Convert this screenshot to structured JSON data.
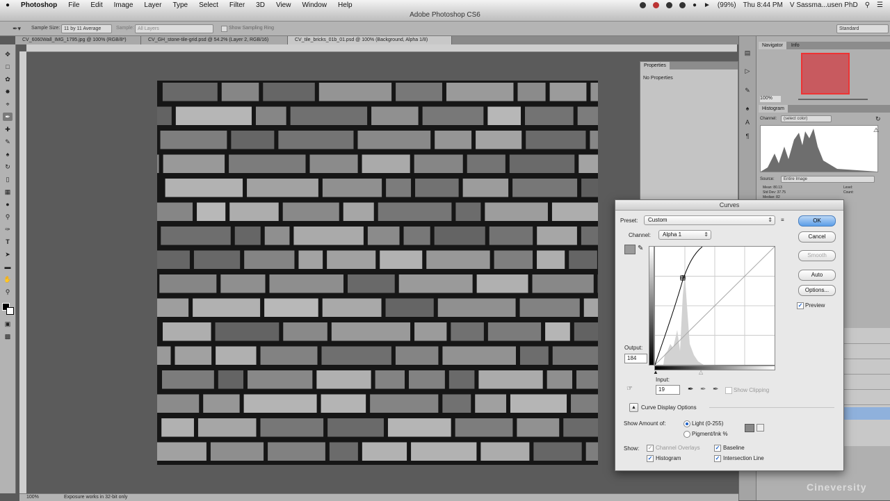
{
  "menubar": {
    "apple": "",
    "app": "Photoshop",
    "items": [
      "File",
      "Edit",
      "Image",
      "Layer",
      "Type",
      "Select",
      "Filter",
      "3D",
      "View",
      "Window",
      "Help"
    ],
    "battery": "(99%)",
    "clock": "Thu 8:44 PM",
    "user": "V Sassma...usen PhD"
  },
  "window": {
    "title": "Adobe Photoshop CS6"
  },
  "options": {
    "sample_size_label": "Sample Size:",
    "sample_size_value": "11 by 11 Average",
    "sample_label": "Sample:",
    "sample_value": "All Layers",
    "show_ring": "Show Sampling Ring",
    "workspace": "Standard"
  },
  "tabs": [
    {
      "label": "CV_6060Wall_IMG_1795.jpg @ 100% (RGB/8*)",
      "active": false
    },
    {
      "label": "CV_GH_stone-tile-grid.psd @ 54.2% (Layer 2, RGB/16)",
      "active": false
    },
    {
      "label": "CV_tile_bricks_01b_01.psd @ 100% (Background, Alpha 1/8)",
      "active": true
    }
  ],
  "properties": {
    "tab": "Properties",
    "empty": "No Properties"
  },
  "right_panels": {
    "navigator_tabs": [
      "Navigator",
      "Info"
    ],
    "zoom": "100%",
    "histogram_tab": "Histogram",
    "channel_label": "Channel:",
    "channel_value": "(select color)",
    "source_label": "Source:",
    "source_value": "Entire Image",
    "stats": [
      "Mean: 80.13",
      "Std Dev: 37.75",
      "Median: 82"
    ],
    "stats_right": [
      "Level:",
      "Count:"
    ]
  },
  "status": {
    "zoom": "100%",
    "doc": "Exposure works in 32-bit only"
  },
  "curves": {
    "title": "Curves",
    "preset_label": "Preset:",
    "preset_value": "Custom",
    "channel_label": "Channel:",
    "channel_value": "Alpha 1",
    "output_label": "Output:",
    "output_value": "184",
    "input_label": "Input:",
    "input_value": "19",
    "show_clipping": "Show Clipping",
    "display_options": "Curve Display Options",
    "show_amount_label": "Show Amount of:",
    "light": "Light  (0-255)",
    "pigment": "Pigment/Ink %",
    "show_label": "Show:",
    "channel_overlays": "Channel Overlays",
    "baseline": "Baseline",
    "histogram": "Histogram",
    "intersection_line": "Intersection Line",
    "buttons": {
      "ok": "OK",
      "cancel": "Cancel",
      "smooth": "Smooth",
      "auto": "Auto",
      "options": "Options..."
    },
    "preview": "Preview"
  },
  "watermark": "Cineversity",
  "colors": {
    "accent": "#5a9ee8",
    "canvas_bg": "#5b5b5b",
    "panel": "#b0b0b0"
  }
}
